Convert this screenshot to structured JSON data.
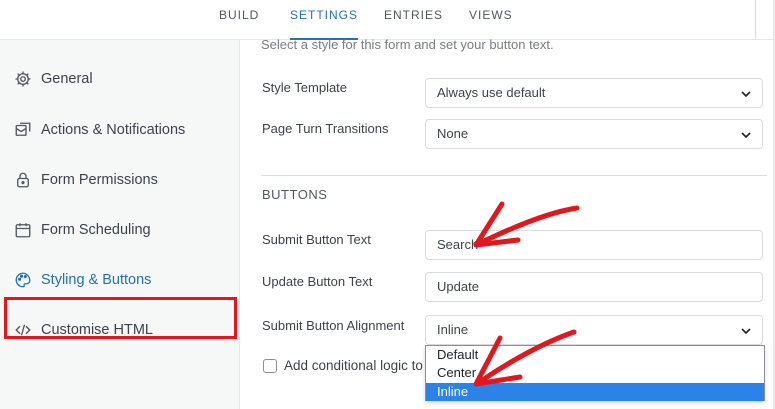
{
  "tabs": [
    {
      "label": "BUILD"
    },
    {
      "label": "SETTINGS",
      "active": true
    },
    {
      "label": "ENTRIES"
    },
    {
      "label": "VIEWS"
    }
  ],
  "sidebar": {
    "items": [
      {
        "label": "General",
        "icon": "gear-icon"
      },
      {
        "label": "Actions & Notifications",
        "icon": "actions-icon"
      },
      {
        "label": "Form Permissions",
        "icon": "lock-icon"
      },
      {
        "label": "Form Scheduling",
        "icon": "calendar-icon"
      },
      {
        "label": "Styling & Buttons",
        "icon": "palette-icon",
        "active": true
      },
      {
        "label": "Customise HTML",
        "icon": "code-icon"
      }
    ]
  },
  "main": {
    "intro": "Select a style for this form and set your button text.",
    "style_template": {
      "label": "Style Template",
      "value": "Always use default"
    },
    "page_turn": {
      "label": "Page Turn Transitions",
      "value": "None"
    },
    "buttons_heading": "BUTTONS",
    "submit_text": {
      "label": "Submit Button Text",
      "value": "Search"
    },
    "update_text": {
      "label": "Update Button Text",
      "value": "Update"
    },
    "submit_alignment": {
      "label": "Submit Button Alignment",
      "value": "Inline"
    },
    "conditional": {
      "label": "Add conditional logic to"
    },
    "alignment_options": [
      {
        "label": "Default"
      },
      {
        "label": "Center"
      },
      {
        "label": "Inline",
        "selected": true
      }
    ]
  },
  "colors": {
    "accent": "#2271b1",
    "highlight_border": "#e4161b",
    "selected_option": "#2b82e8"
  }
}
